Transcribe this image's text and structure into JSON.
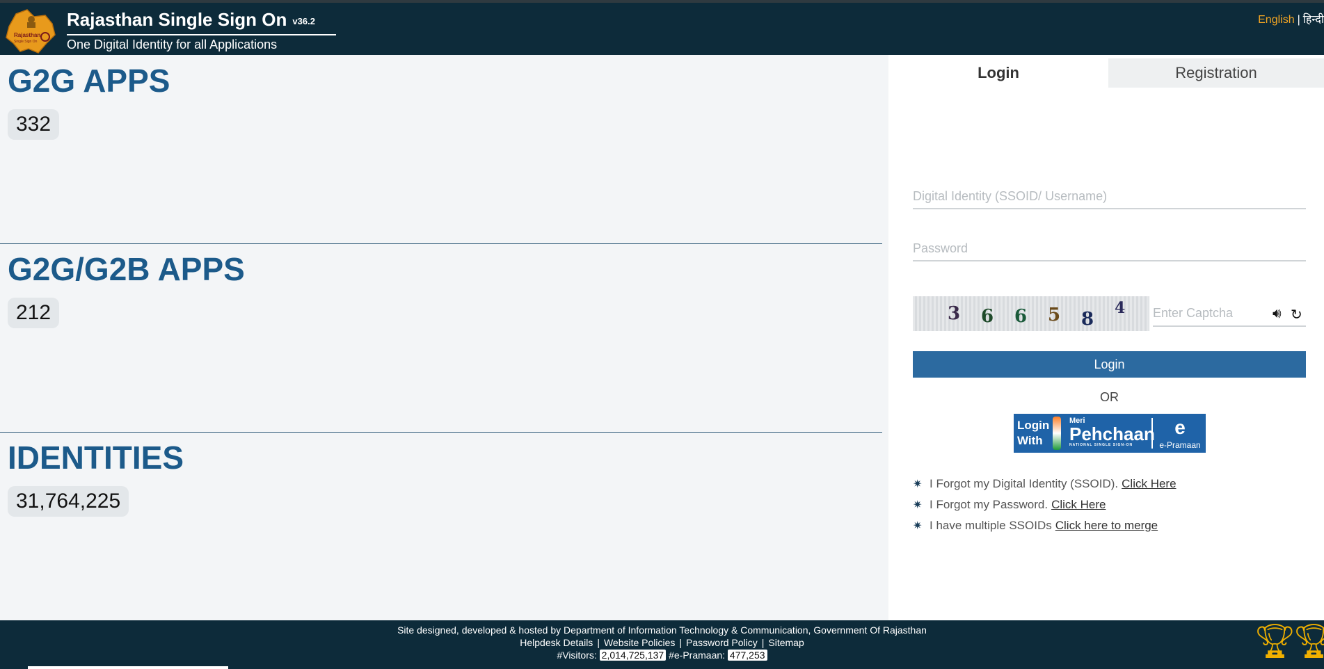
{
  "header": {
    "title": "Rajasthan Single Sign On",
    "version": "v36.2",
    "tagline": "One Digital Identity for all Applications",
    "lang_english": "English",
    "lang_sep": "|",
    "lang_hindi": "हिन्दी"
  },
  "stats": [
    {
      "title": "G2G APPS",
      "count": "332"
    },
    {
      "title": "G2G/G2B APPS",
      "count": "212"
    },
    {
      "title": "IDENTITIES",
      "count": "31,764,225"
    }
  ],
  "tabs": {
    "login": "Login",
    "registration": "Registration"
  },
  "form": {
    "ssoid_placeholder": "Digital Identity (SSOID/ Username)",
    "password_placeholder": "Password",
    "captcha_placeholder": "Enter Captcha",
    "captcha_digits": [
      "3",
      "6",
      "6",
      "5",
      "8",
      "4"
    ],
    "login_button": "Login",
    "or": "OR"
  },
  "pehchaan": {
    "login_with_1": "Login",
    "login_with_2": "With",
    "meri": "Meri",
    "pehchaan": "Pehchaan",
    "nsso": "NATIONAL SINGLE SIGN-ON",
    "eprama_text": "e-Pramaan"
  },
  "help_links": [
    {
      "text": "I Forgot my Digital Identity (SSOID).",
      "link": "Click Here"
    },
    {
      "text": "I Forgot my Password.",
      "link": "Click Here"
    },
    {
      "text": "I have multiple SSOIDs",
      "link": "Click here to merge"
    }
  ],
  "footer": {
    "designed_by": "Site designed, developed & hosted by Department of Information Technology & Communication, Government Of Rajasthan",
    "helpdesk": "Helpdesk Details",
    "policies": "Website Policies",
    "password_policy": "Password Policy",
    "sitemap": "Sitemap",
    "visitors_label": "#Visitors:",
    "visitors_count": "2,014,725,137",
    "epramaan_label": "#e-Pramaan:",
    "epramaan_count": "477,253"
  },
  "colors": {
    "header_bg": "#0d2b3a",
    "stat_title": "#1c5a8a",
    "login_button": "#2c6aa0",
    "lang_active": "#f5a623"
  },
  "icons": [
    "rajasthan-logo",
    "speaker-icon",
    "refresh-icon",
    "trophy-icon"
  ]
}
